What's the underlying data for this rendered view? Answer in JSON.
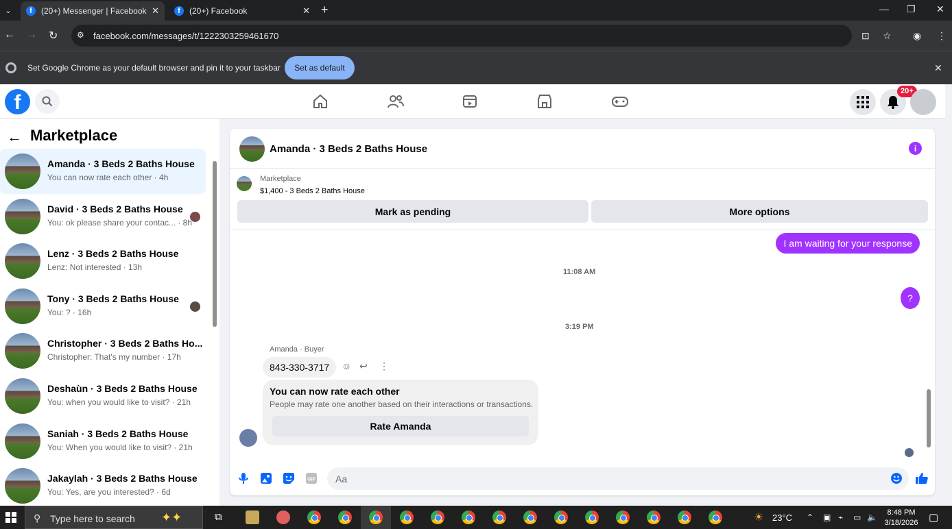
{
  "browser": {
    "tabs": [
      {
        "title": "(20+) Messenger | Facebook",
        "favicon": "f"
      },
      {
        "title": "(20+) Facebook",
        "favicon": "f"
      }
    ],
    "url": "facebook.com/messages/t/1222303259461670",
    "infobar": {
      "message": "Set Google Chrome as your default browser and pin it to your taskbar",
      "button": "Set as default"
    }
  },
  "fb_header": {
    "logo": "f",
    "notification_badge": "20+",
    "nav_icons": [
      "home-icon",
      "friends-icon",
      "video-icon",
      "marketplace-icon",
      "gaming-icon"
    ]
  },
  "marketplace": {
    "title": "Marketplace",
    "conversations": [
      {
        "name": "Amanda · 3 Beds 2 Baths House",
        "snippet": "You can now rate each other · 4h",
        "selected": true
      },
      {
        "name": "David · 3 Beds 2 Baths House",
        "snippet": "You: ok please share your contac... · 8h"
      },
      {
        "name": "Lenz · 3 Beds 2 Baths House",
        "snippet": "Lenz: Not interested · 13h"
      },
      {
        "name": "Tony · 3 Beds 2 Baths House",
        "snippet": "You: ? · 16h"
      },
      {
        "name": "Christopher · 3 Beds 2 Baths Ho...",
        "snippet": "Christopher: That's my number · 17h"
      },
      {
        "name": "Deshaùn · 3 Beds 2 Baths House",
        "snippet": "You: when you would like to visit? · 21h"
      },
      {
        "name": "Saniah · 3 Beds 2 Baths House",
        "snippet": "You: When you would like to visit? · 21h"
      },
      {
        "name": "Jakaylah · 3 Beds 2 Baths House",
        "snippet": "You: Yes, are you interested? · 6d"
      }
    ]
  },
  "chat": {
    "title": "Amanda · 3 Beds 2 Baths House",
    "listing": {
      "category": "Marketplace",
      "price_title": "$1,400 - 3 Beds 2 Baths House",
      "mark_pending": "Mark as pending",
      "more_options": "More options"
    },
    "messages": {
      "out1": "I am waiting for your response",
      "time1": "11:08 AM",
      "out2": "?",
      "time2": "3:19 PM",
      "sender": "Amanda · Buyer",
      "in1": "843-330-3717"
    },
    "rate_card": {
      "heading": "You can now rate each other",
      "subtext": "People may rate one another based on their interactions or transactions.",
      "button": "Rate Amanda"
    },
    "composer": {
      "placeholder": "Aa"
    }
  },
  "taskbar": {
    "search_placeholder": "Type here to search",
    "temperature": "23°C",
    "time": "8:48 PM",
    "date": "3/18/2026"
  },
  "colors": {
    "fb_blue": "#1877f2",
    "messenger_purple": "#a033ff",
    "selected_bg": "#ebf5ff"
  }
}
